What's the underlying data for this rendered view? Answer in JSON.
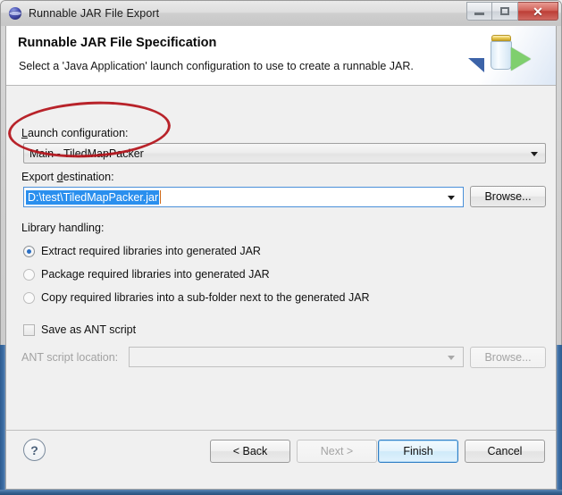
{
  "window": {
    "title": "Runnable JAR File Export",
    "icon": "eclipse-export-icon",
    "buttons": {
      "minimize": "minimize-button",
      "maximize": "maximize-button",
      "close_glyph": "✕"
    }
  },
  "banner": {
    "title": "Runnable JAR File Specification",
    "description": "Select a 'Java Application' launch configuration to use to create a runnable JAR.",
    "graphic": "jar-with-run-arrow-icon"
  },
  "form": {
    "launch_configuration": {
      "label": "Launch configuration:",
      "label_prefix": "L",
      "value": "Main - TiledMapPacker"
    },
    "export_destination": {
      "label": "Export destination:",
      "label_underlined_char": "d",
      "value": "D:\\test\\TiledMapPacker.jar",
      "selected": true,
      "browse_label": "Browse..."
    },
    "library_handling": {
      "label": "Library handling:",
      "options": [
        {
          "label": "Extract required libraries into generated JAR",
          "checked": true
        },
        {
          "label": "Package required libraries into generated JAR",
          "checked": false
        },
        {
          "label": "Copy required libraries into a sub-folder next to the generated JAR",
          "checked": false
        }
      ]
    },
    "save_ant": {
      "label": "Save as ANT script",
      "checked": false
    },
    "ant_location": {
      "label": "ANT script location:",
      "value": "",
      "disabled": true,
      "browse_label": "Browse..."
    }
  },
  "footer": {
    "help": "?",
    "back": "< Back",
    "next": "Next >",
    "finish": "Finish",
    "cancel": "Cancel",
    "back_enabled": true,
    "next_enabled": false,
    "finish_default": true
  },
  "annotation": {
    "type": "red-ellipse-highlight",
    "color": "#b4131b",
    "target": "launch-configuration-combobox"
  },
  "colors": {
    "accent_blue": "#2a8fee",
    "annotation_red": "#b4131b",
    "dialog_bg": "#f0f0f0",
    "banner_bg": "#ffffff"
  }
}
